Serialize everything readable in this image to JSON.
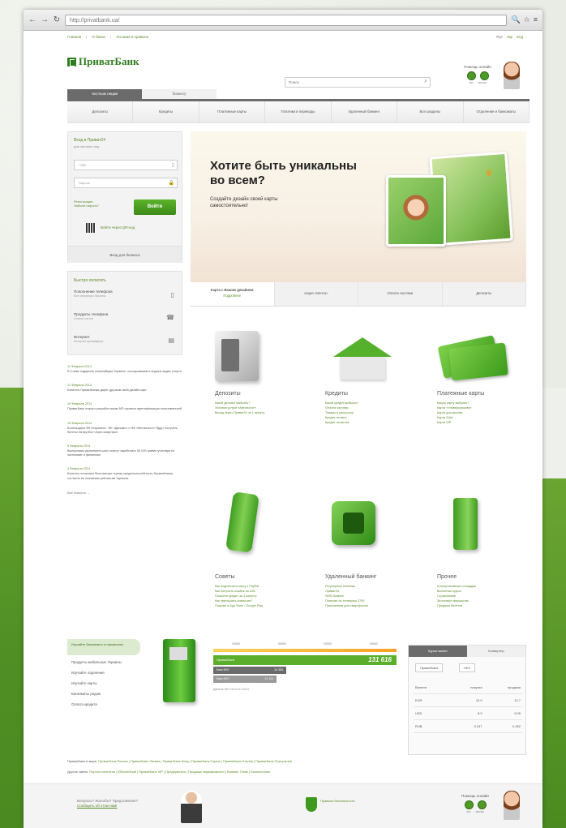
{
  "browser": {
    "url": "http://privatbank.ua/",
    "back": "←",
    "forward": "→",
    "reload": "↻",
    "icons": [
      "🔍",
      "☆",
      "≡"
    ]
  },
  "top_links": [
    "Главная",
    "О банке",
    "Условия и правила"
  ],
  "lang": {
    "items": [
      "Рус",
      "Укр",
      "Eng"
    ]
  },
  "logo": "ПриватБанк",
  "search": {
    "placeholder": "Поиск",
    "icon": "⌕"
  },
  "help": {
    "title": "Помощь онлайн",
    "captions": [
      "чат",
      "звонок"
    ]
  },
  "tabs": [
    "частным лицам",
    "бизнесу"
  ],
  "mainnav": [
    "Депозиты",
    "Кредиты",
    "Платежные карты",
    "Платежи и переводы",
    "Удаленный банкинг",
    "Все разделы",
    "Отделения и банкоматы"
  ],
  "login": {
    "title": "Вход в Приват24",
    "subtitle": "для частных лиц",
    "phone": "+380",
    "password": "Пароль",
    "phone_icon": "▯",
    "password_icon": "🔒",
    "forgot": "Регистрация Забыли пароль?",
    "button": "Войти",
    "qr_text": "Войти через QR-код",
    "business": "Вход для бизнеса"
  },
  "quick_pay": {
    "title": "Быстро оплатить",
    "items": [
      {
        "title": "Пополнение телефона",
        "sub": "Все операторы Украины",
        "icon": "▯"
      },
      {
        "title": "Продукты телефона",
        "sub": "Оплата счетов",
        "icon": "☎"
      },
      {
        "title": "Интернет",
        "sub": "Интернет-провайдеры",
        "icon": "▤"
      }
    ]
  },
  "news": [
    {
      "date": "11 Февраля 2014",
      "text": "В Славе подарили олимпийцам Украины, послушавшим в водных видах спорта"
    },
    {
      "date": "11 Февраля 2014",
      "text": "Клиенты ПриватБанка дарят друзьям свой дизайн карт"
    },
    {
      "date": "10 Февраля 2014",
      "text": "ПриватБанк открыл разработчикам API сервиса идентификации пользователей"
    },
    {
      "date": "10 Февраля 2014",
      "text": "Болельщики ФК «Карпаты», ФК «Динамо» и ФК «Металлист» будут получать билеты на футбол через смартфон"
    },
    {
      "date": "5 Февраля 2014",
      "text": "Выпускники украинских школ смогут заработать 50 000 гривен участвуя по экономике и финансам"
    },
    {
      "date": "4 Февраля 2014",
      "text": "Клиенты получают бесплатную оценку кредитоспособности ПриватБанка согласно ее основным рейтингам Украины"
    }
  ],
  "news_all": "Все новости →",
  "banner": {
    "title": "Хотите быть уникальны во всем?",
    "text": "Создайте дизайн своей карты самостоятельно!",
    "butterfly": "❦",
    "tabs": [
      {
        "label": "Карта с Вашим дизайном",
        "sub": "Подробнее"
      },
      {
        "label": "Акция «Мечта»"
      },
      {
        "label": "Оплата частями"
      },
      {
        "label": "Депозиты"
      }
    ]
  },
  "products": [
    {
      "title": "Депозиты",
      "links": [
        "Какой депозит выбрать?",
        "Условия услуги «Автопилот»",
        "Вклад через Приват24 за 1 минуту"
      ]
    },
    {
      "title": "Кредиты",
      "links": [
        "Какой кредит выбрать?",
        "Оплата частями",
        "Товары в рассрочку",
        "Кредит на авто",
        "Кредит на жилье"
      ]
    },
    {
      "title": "Платежные карты",
      "links": [
        "Какую карту выбрать?",
        "Карта «Универсальная»",
        "Карта для выплат",
        "Карта Gold",
        "Карта VIP"
      ]
    },
    {
      "title": "Советы",
      "links": [
        "Как подключить карту к PayPal",
        "Как получить кэшбэк на АЗС",
        "Погасите кредит за 1 минуту!",
        "Как уменьшить комиссии?",
        "Покупки в App Store / Google Play"
      ]
    },
    {
      "title": "Удаленный банкинг",
      "links": [
        "Регулярные платежи",
        "Приват24",
        "SMS-банкинг",
        "Платежи по телефону 3700",
        "Приложения для смартфонов"
      ]
    },
    {
      "title": "Прочее",
      "links": [
        "Альтернативные площадки",
        "Валютные курсы",
        "Страхование",
        "Залоговое имущество",
        "Продажа билетов"
      ]
    }
  ],
  "atm": {
    "head": "Изучайте банкоматы и терминалы",
    "list": [
      "Продукты мобильные Украины",
      "Изучайте отделения",
      "Изучайте карты",
      "Банкоматы рядом",
      "Оплата кредита"
    ]
  },
  "rates": {
    "scale": [
      "00000",
      "00000",
      "00000",
      "00000"
    ],
    "bank": "ПриватБанк",
    "total": "131 616",
    "bars": [
      {
        "label": "Банк НБУ",
        "value": "24 306"
      },
      {
        "label": "Банк НБУ",
        "value": "11 124"
      }
    ],
    "note": "Данные НБУ на 01.01.2014"
  },
  "currency": {
    "tabs": [
      "Курсы валют",
      "Конвертер"
    ],
    "select": [
      "ПриватБанк",
      "НБУ"
    ],
    "header": [
      "Валюта",
      "покупка",
      "продажа"
    ],
    "rows": [
      [
        "EUR",
        "12.0",
        "12.7"
      ],
      [
        "USD",
        "8.9",
        "9.05"
      ],
      [
        "RUB",
        "0.247",
        "0.262"
      ]
    ]
  },
  "footer_links": {
    "row1_label": "ПриватБанк в мире:",
    "row1": "ПриватБанк Россия | ПриватБанк Латвия | ПриватБанк Кипр | ПриватБанк Грузия | ПриватБанк Италия | ПриватБанк Португалия",
    "row2_label": "Другие сайты:",
    "row2": "Портал клиентов | Юбилейный | ПриватБанк VIP | Предприятия | Продажа недвижимости | Банкинг Плюс | Бизнесполис"
  },
  "footer": {
    "question": "Вопросы? Жалобы? Предложения?",
    "link": "Сообщить об этом нам!",
    "shield": "Правила безопасности",
    "help": "Помощь онлайн",
    "captions": [
      "чат",
      "звонок"
    ]
  }
}
